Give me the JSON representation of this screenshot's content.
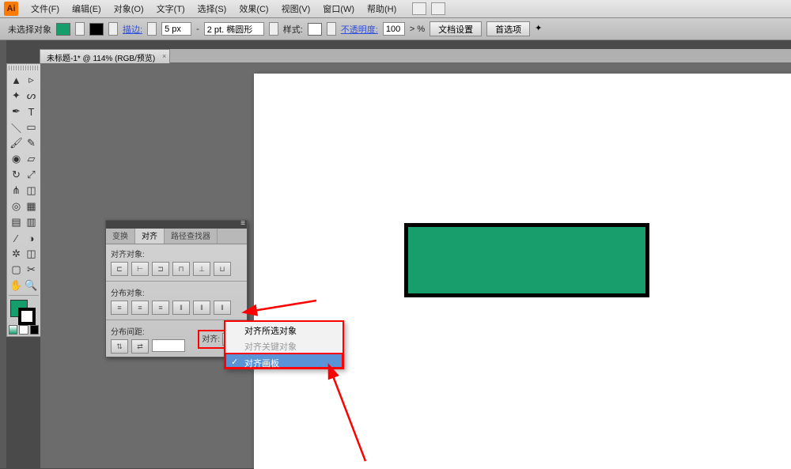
{
  "app_icon": "Ai",
  "menu": {
    "file": "文件(F)",
    "edit": "编辑(E)",
    "object": "对象(O)",
    "type": "文字(T)",
    "select": "选择(S)",
    "effect": "效果(C)",
    "view": "视图(V)",
    "window": "窗口(W)",
    "help": "帮助(H)"
  },
  "options": {
    "no_selection": "未选择对象",
    "stroke_label": "描边:",
    "stroke_value": "5 px",
    "dash": "-",
    "brush_value": "2 pt. 椭圆形",
    "style_label": "样式:",
    "opacity_label": "不透明度:",
    "opacity_value": "100",
    "opacity_unit": "> %",
    "doc_setup": "文档设置",
    "preferences": "首选项"
  },
  "doctab": {
    "title": "未标题-1* @ 114% (RGB/预览)"
  },
  "panel": {
    "tabs": {
      "transform": "变换",
      "align": "对齐",
      "pathfinder": "路径查找器"
    },
    "align_objects": "对齐对象:",
    "distribute_objects": "分布对象:",
    "distribute_spacing": "分布间距:",
    "align_to": "对齐:"
  },
  "popup": {
    "opt1": "对齐所选对象",
    "opt2": "对齐关键对象",
    "opt3": "对齐画板"
  }
}
